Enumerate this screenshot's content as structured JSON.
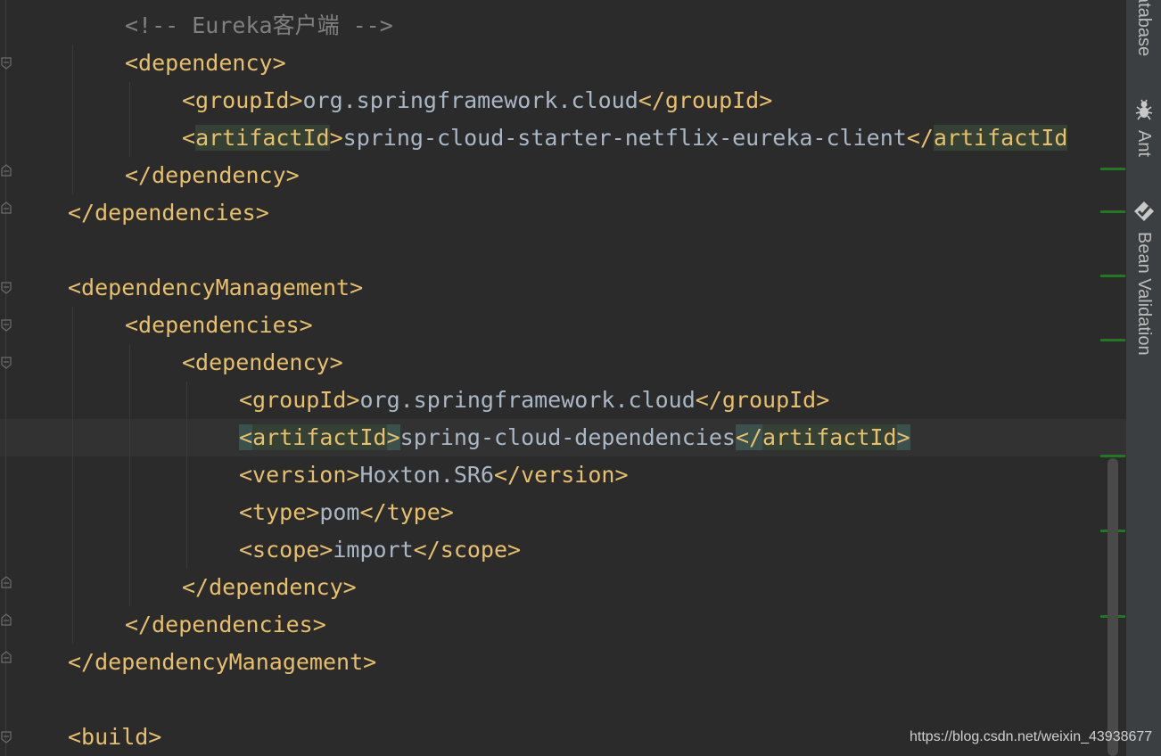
{
  "editor": {
    "lines": [
      {
        "indent": 140,
        "parts": [
          {
            "t": "<!-- Eureka客户端 -->",
            "c": "cmt"
          }
        ]
      },
      {
        "indent": 140,
        "parts": [
          {
            "t": "<dependency>",
            "c": "tag"
          }
        ]
      },
      {
        "indent": 204,
        "parts": [
          {
            "t": "<groupId>",
            "c": "tag"
          },
          {
            "t": "org.springframework.cloud",
            "c": "txt"
          },
          {
            "t": "</groupId>",
            "c": "tag"
          }
        ]
      },
      {
        "indent": 204,
        "parts": [
          {
            "t": "<",
            "c": "tag"
          },
          {
            "t": "artifactId",
            "c": "tag hl"
          },
          {
            "t": ">",
            "c": "tag"
          },
          {
            "t": "spring-cloud-starter-netflix-eureka-client",
            "c": "txt"
          },
          {
            "t": "</",
            "c": "tag"
          },
          {
            "t": "artifactId",
            "c": "tag hl"
          }
        ]
      },
      {
        "indent": 140,
        "parts": [
          {
            "t": "</dependency>",
            "c": "tag"
          }
        ]
      },
      {
        "indent": 76,
        "parts": [
          {
            "t": "</dependencies>",
            "c": "tag"
          }
        ]
      },
      {
        "indent": 76,
        "parts": []
      },
      {
        "indent": 76,
        "parts": [
          {
            "t": "<dependencyManagement>",
            "c": "tag"
          }
        ]
      },
      {
        "indent": 140,
        "parts": [
          {
            "t": "<dependencies>",
            "c": "tag"
          }
        ]
      },
      {
        "indent": 204,
        "parts": [
          {
            "t": "<dependency>",
            "c": "tag"
          }
        ]
      },
      {
        "indent": 268,
        "parts": [
          {
            "t": "<groupId>",
            "c": "tag"
          },
          {
            "t": "org.springframework.cloud",
            "c": "txt"
          },
          {
            "t": "</groupId>",
            "c": "tag"
          }
        ]
      },
      {
        "indent": 268,
        "parts": [
          {
            "t": "<",
            "c": "tag hl2"
          },
          {
            "t": "artifactId",
            "c": "tag hl"
          },
          {
            "t": ">",
            "c": "tag hl2"
          },
          {
            "t": "spring-cloud-dependencies",
            "c": "txt"
          },
          {
            "t": "</",
            "c": "tag hl2"
          },
          {
            "t": "artifactId",
            "c": "tag hl"
          },
          {
            "t": ">",
            "c": "tag hl2"
          }
        ]
      },
      {
        "indent": 268,
        "parts": [
          {
            "t": "<version>",
            "c": "tag"
          },
          {
            "t": "Hoxton.SR6",
            "c": "txt"
          },
          {
            "t": "</version>",
            "c": "tag"
          }
        ]
      },
      {
        "indent": 268,
        "parts": [
          {
            "t": "<type>",
            "c": "tag"
          },
          {
            "t": "pom",
            "c": "txt"
          },
          {
            "t": "</type>",
            "c": "tag"
          }
        ]
      },
      {
        "indent": 268,
        "parts": [
          {
            "t": "<scope>",
            "c": "tag"
          },
          {
            "t": "import",
            "c": "txt"
          },
          {
            "t": "</scope>",
            "c": "tag"
          }
        ]
      },
      {
        "indent": 204,
        "parts": [
          {
            "t": "</dependency>",
            "c": "tag"
          }
        ]
      },
      {
        "indent": 140,
        "parts": [
          {
            "t": "</dependencies>",
            "c": "tag"
          }
        ]
      },
      {
        "indent": 76,
        "parts": [
          {
            "t": "</dependencyManagement>",
            "c": "tag"
          }
        ]
      },
      {
        "indent": 76,
        "parts": []
      },
      {
        "indent": 76,
        "parts": [
          {
            "t": "<build>",
            "c": "tag"
          }
        ]
      }
    ]
  },
  "sidebar": {
    "database_label": "atabase",
    "ant_label": "Ant",
    "bean_label": "Bean Validation",
    "ant_icon": "ant-icon",
    "bean_icon": "bean-validation-icon"
  },
  "watermark": "https://blog.csdn.net/weixin_43938677"
}
